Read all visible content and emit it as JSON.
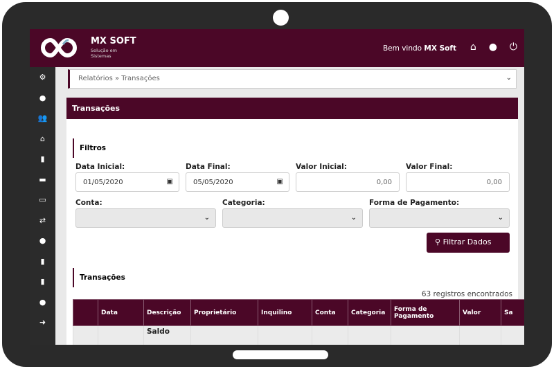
{
  "header": {
    "brand": "MX SOFT",
    "tagline_1": "Solução em",
    "tagline_2": "Sistemas",
    "welcome": "Bem vindo ",
    "user": "MX Soft"
  },
  "sidebar": {
    "items": [
      "cogs-icon",
      "globe-icon",
      "users-icon",
      "home-icon",
      "file-icon",
      "money-icon",
      "card-icon",
      "exchange-icon",
      "comments-icon",
      "document-icon",
      "book-icon",
      "user-icon",
      "arrow-right-icon"
    ]
  },
  "breadcrumb": "Relatórios » Transações",
  "page_title": "Transações",
  "filters": {
    "title": "Filtros",
    "data_inicial_label": "Data Inicial:",
    "data_inicial": "01/05/2020",
    "data_final_label": "Data Final:",
    "data_final": "05/05/2020",
    "valor_inicial_label": "Valor Inicial:",
    "valor_inicial": "0,00",
    "valor_final_label": "Valor Final:",
    "valor_final": "0,00",
    "conta_label": "Conta:",
    "categoria_label": "Categoria:",
    "forma_label": "Forma de Pagamento:",
    "button": "Filtrar Dados"
  },
  "results": {
    "title": "Transações",
    "count": "63 registros encontrados",
    "columns": [
      "",
      "Data",
      "Descrição",
      "Proprietário",
      "Inquilino",
      "Conta",
      "Categoria",
      "Forma de Pagamento",
      "Valor",
      "Sa"
    ],
    "rows": [
      [
        "",
        "",
        "Saldo",
        "",
        "",
        "",
        "",
        "",
        "",
        ""
      ]
    ]
  },
  "colors": {
    "brand": "#4b0727",
    "sidebar": "#2b2b2b"
  }
}
